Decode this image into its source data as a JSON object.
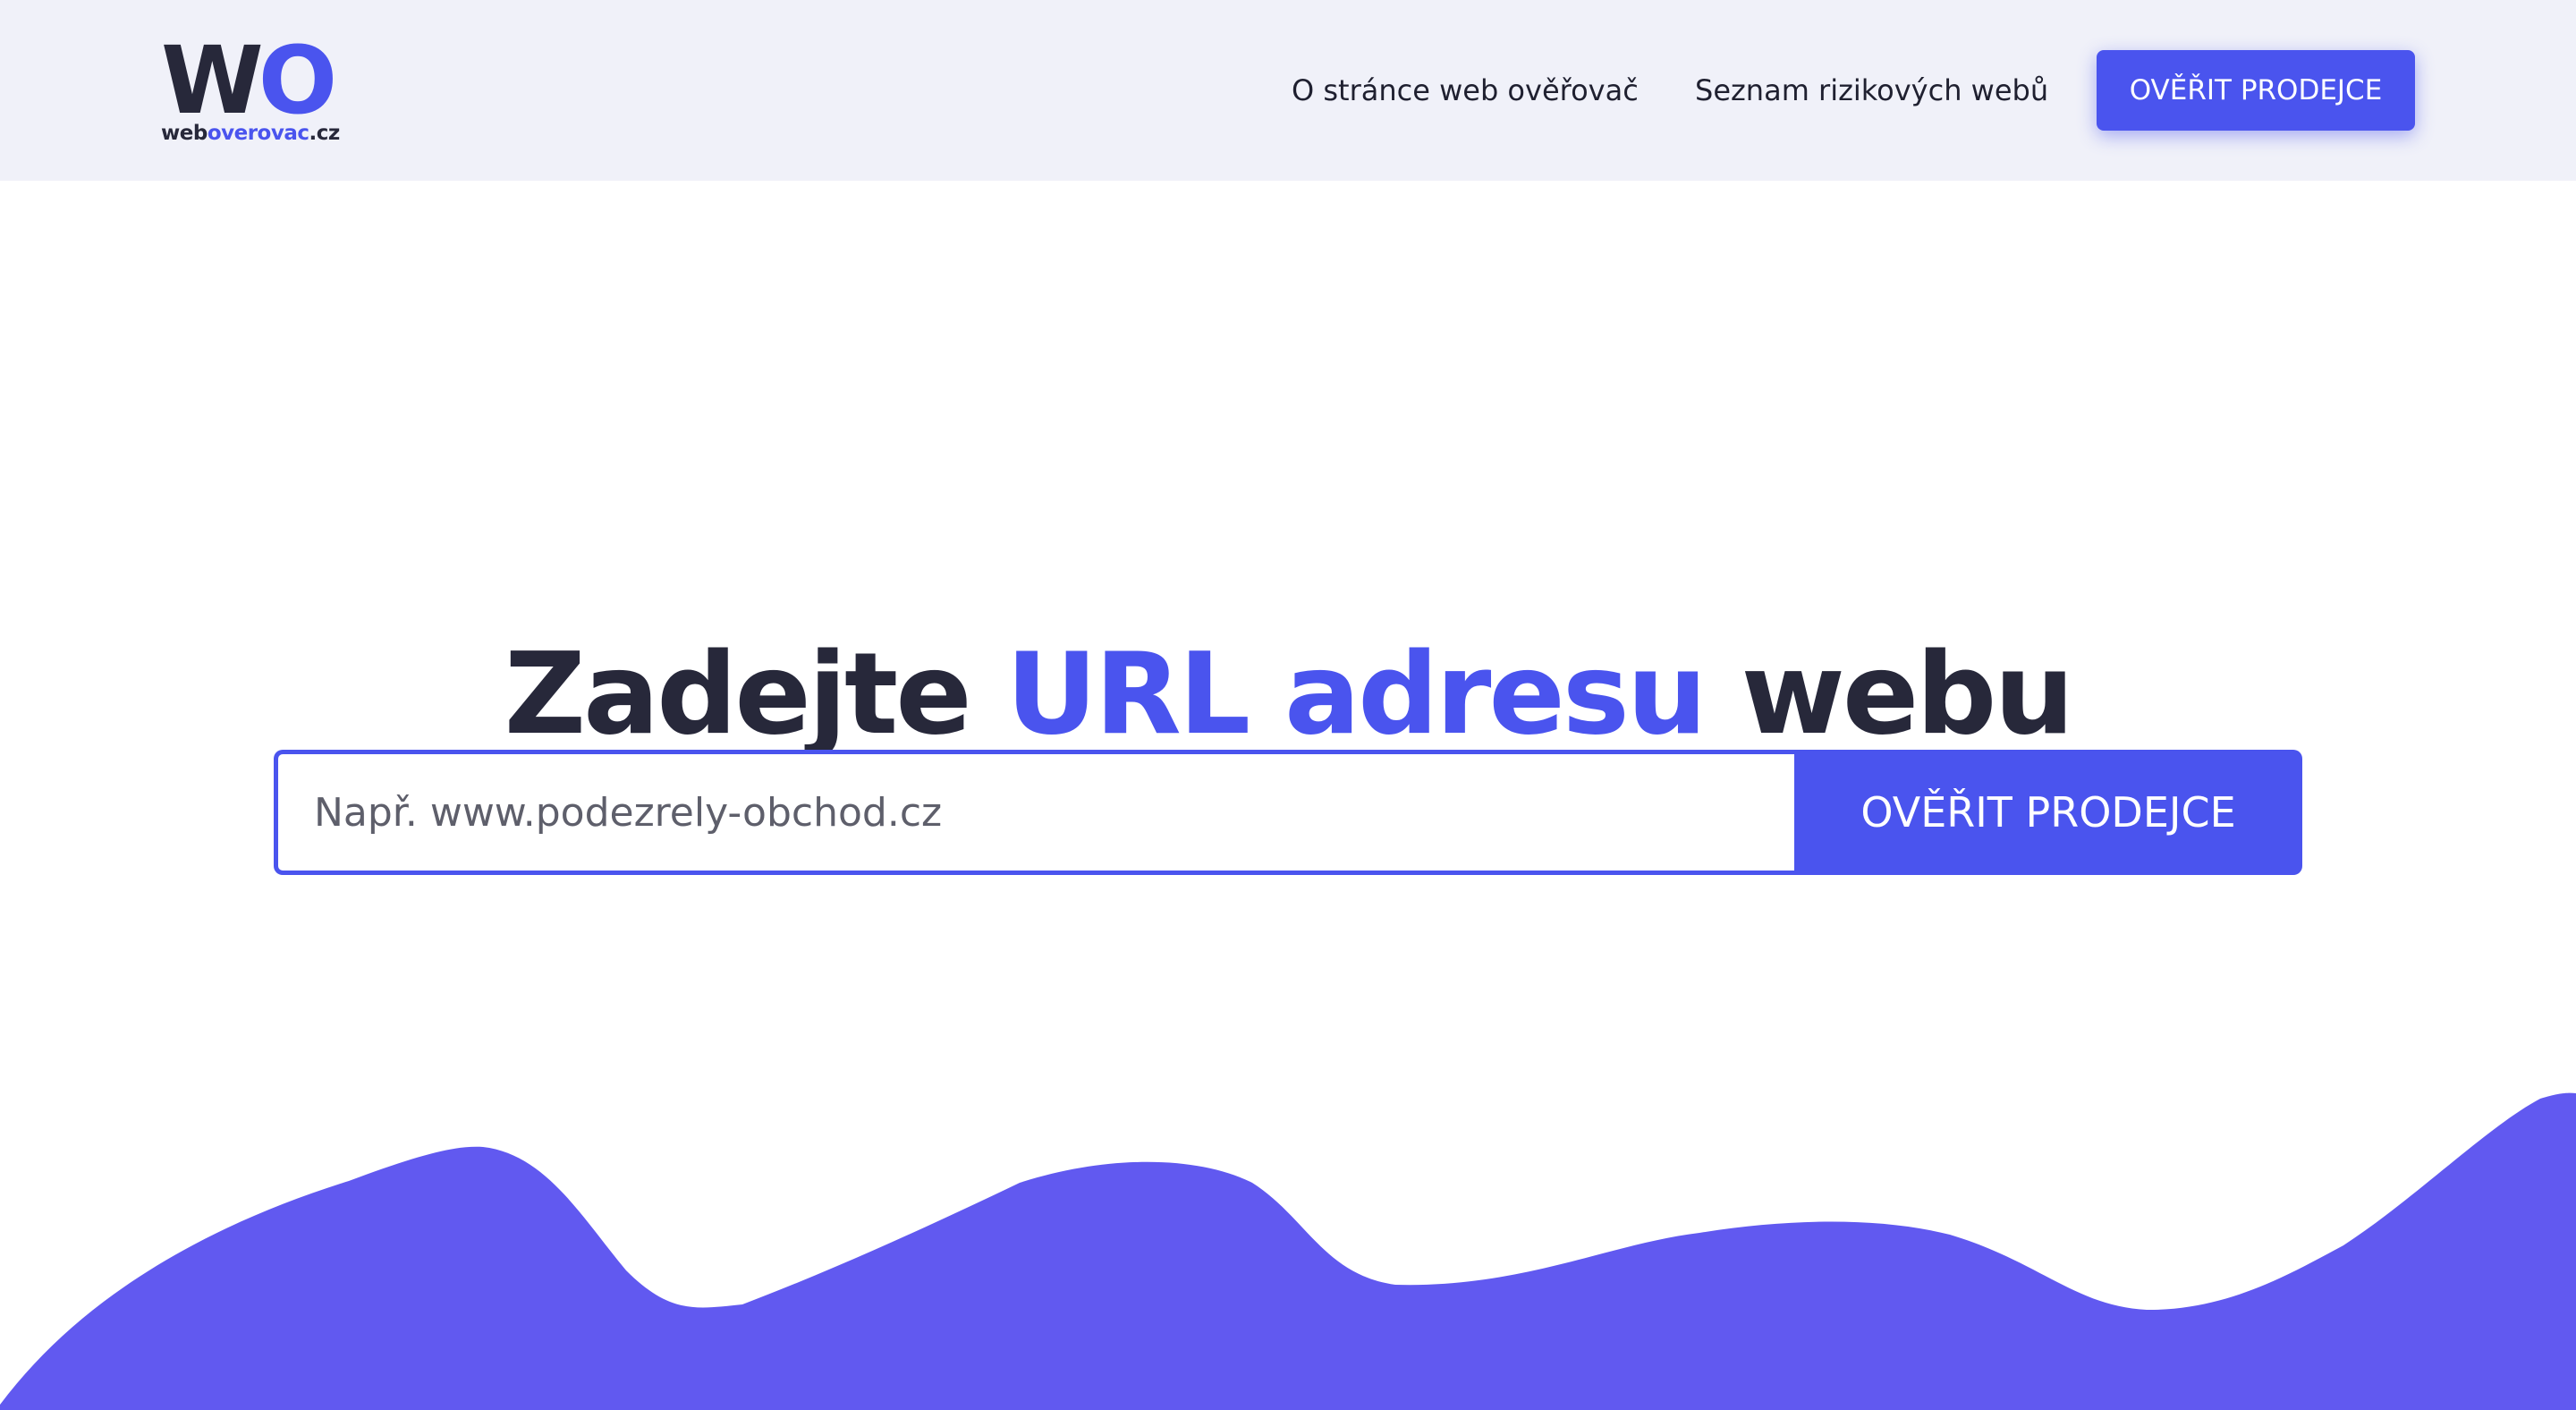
{
  "brand": {
    "mark_w": "W",
    "mark_o": "O",
    "domain_web": "web",
    "domain_mid": "overovac",
    "domain_cz": ".cz"
  },
  "nav": {
    "about": "O stránce web ověřovač",
    "risky": "Seznam rizikových webů",
    "cta": "OVĚŘIT PRODEJCE"
  },
  "hero": {
    "title_start": "Zadejte",
    "title_accent": "URL adresu",
    "title_end": "webu"
  },
  "search": {
    "value": "",
    "placeholder": "Např. www.podezrely-obchod.cz",
    "button_label": "OVĚŘIT PRODEJCE"
  },
  "colors": {
    "accent": "#4a54ee",
    "dark": "#27283a",
    "header_bg": "#f0f1f9",
    "wave": "#6159f0"
  }
}
